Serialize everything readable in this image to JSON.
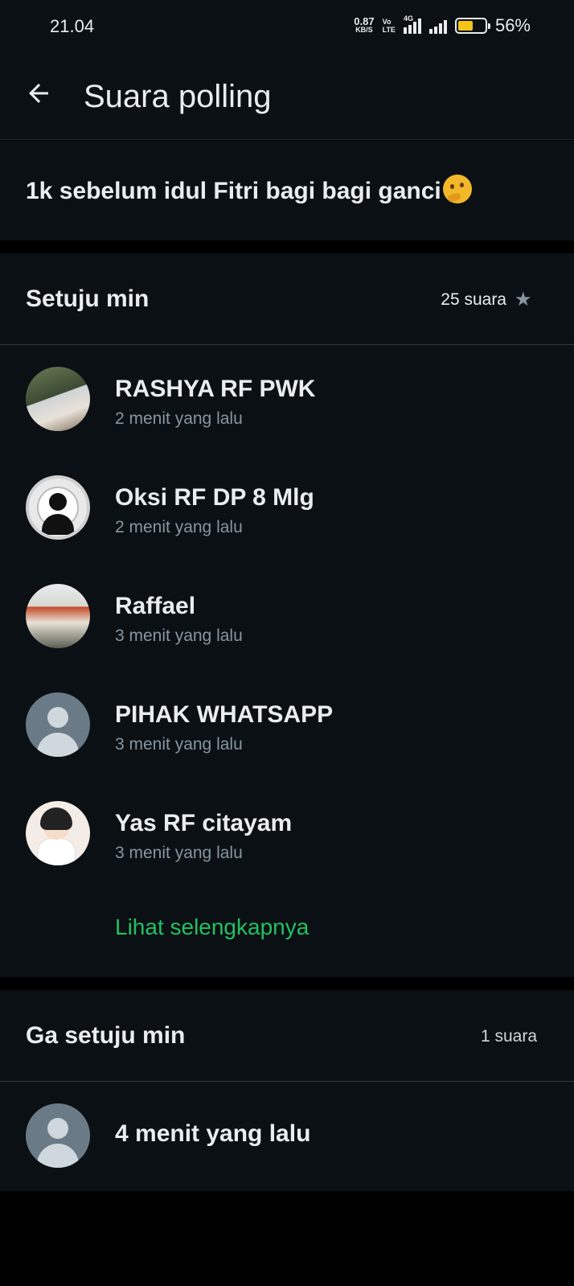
{
  "status_bar": {
    "time": "21.04",
    "net_speed_value": "0.87",
    "net_speed_unit": "KB/S",
    "volte_top": "Vo",
    "volte_bottom": "LTE",
    "network_type": "4G",
    "battery_percent_label": "56%",
    "battery_level": 0.56,
    "battery_color": "#f5c518"
  },
  "app_bar": {
    "back_icon": "arrow-left-icon",
    "title": "Suara polling"
  },
  "poll": {
    "question": "1k sebelum idul Fitri bagi bagi ganci",
    "question_emoji": "thinking-face-emoji"
  },
  "options": [
    {
      "name": "Setuju min",
      "count": "25 suara",
      "star_icon": "star-icon",
      "voters": [
        {
          "name": "RASHYA RF PWK",
          "time": "2 menit yang lalu"
        },
        {
          "name": "Oksi RF DP 8 Mlg",
          "time": "2 menit yang lalu"
        },
        {
          "name": "Raffael",
          "time": "3 menit yang lalu"
        },
        {
          "name": "PIHAK WHATSAPP",
          "time": "3 menit yang lalu"
        },
        {
          "name": "Yas RF citayam",
          "time": "3 menit yang lalu"
        }
      ],
      "see_more": "Lihat selengkapnya"
    },
    {
      "name": "Ga setuju min",
      "count": "1 suara",
      "voters": [
        {
          "name": "4 menit yang lalu"
        }
      ]
    }
  ],
  "colors": {
    "accent_green": "#21c063",
    "background": "#0b1014",
    "secondary_text": "#8696a0"
  }
}
